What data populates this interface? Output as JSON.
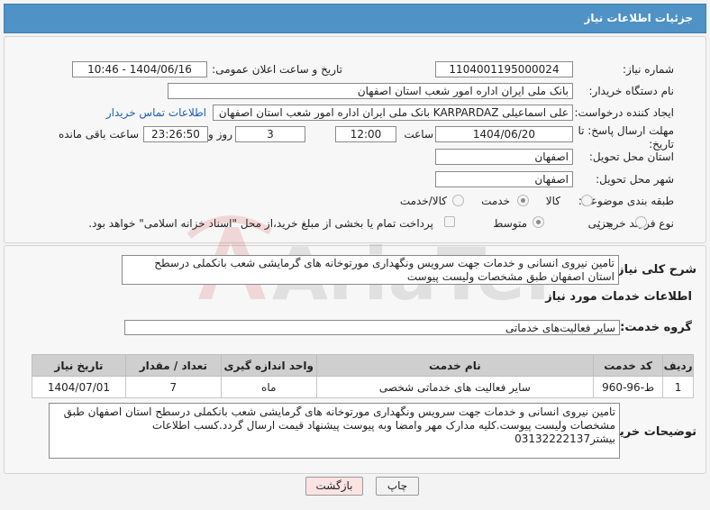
{
  "header": {
    "title": "جزئیات اطلاعات نیاز"
  },
  "form": {
    "need_number": {
      "label": "شماره نیاز:",
      "value": "1104001195000024"
    },
    "announce_datetime": {
      "label": "تاریخ و ساعت اعلان عمومی:",
      "value": "1404/06/16 - 10:46"
    },
    "buyer_org": {
      "label": "نام دستگاه خریدار:",
      "value": "بانک ملی ایران اداره امور شعب استان اصفهان"
    },
    "requester": {
      "label": "ایجاد کننده درخواست:",
      "value": "علی اسماعیلی KARPARDAZ بانک ملی ایران اداره امور شعب استان اصفهان",
      "contact_link": "اطلاعات تماس خریدار"
    },
    "deadline": {
      "label": "مهلت ارسال پاسخ: تا تاریخ:",
      "date": "1404/06/20",
      "time_label": "ساعت",
      "time": "12:00",
      "days": "3",
      "days_label": "روز و",
      "remaining": "23:26:50",
      "remaining_label": "ساعت باقی مانده"
    },
    "delivery_province": {
      "label": "استان محل تحویل:",
      "value": "اصفهان"
    },
    "delivery_city": {
      "label": "شهر محل تحویل:",
      "value": "اصفهان"
    },
    "category": {
      "label": "طبقه بندی موضوعی:",
      "options": [
        "کالا",
        "خدمت",
        "کالا/خدمت"
      ],
      "selected": "خدمت"
    },
    "process_type": {
      "label": "نوع فرآیند خرید :",
      "options": [
        "جزیی",
        "متوسط"
      ],
      "selected": "متوسط",
      "payment_note": "پرداخت تمام یا بخشی از مبلغ خرید،از محل \"اسناد خزانه اسلامی\" خواهد بود."
    }
  },
  "details": {
    "general_desc_label": "شرح کلی نیاز:",
    "general_desc": "تامین نیروی انسانی و خدمات جهت سرویس ونگهداری مورتوخانه های گرمایشی شعب بانکملی درسطح استان اصفهان طبق مشخصات ولیست پیوست",
    "services_title": "اطلاعات خدمات مورد نیاز",
    "service_group_label": "گروه خدمت:",
    "service_group": "سایر فعالیت‌های خدماتی",
    "table": {
      "headers": [
        "ردیف",
        "کد خدمت",
        "نام خدمت",
        "واحد اندازه گیری",
        "تعداد / مقدار",
        "تاریخ نیاز"
      ],
      "rows": [
        [
          "1",
          "ط-96-960",
          "سایر فعالیت های خدماتی شخصی",
          "ماه",
          "7",
          "1404/07/01"
        ]
      ]
    },
    "buyer_notes_label": "توضیحات خریدار:",
    "buyer_notes": "تامین نیروی انسانی و خدمات جهت سرویس ونگهداری مورتوخانه های گرمایشی شعب بانکملی درسطح استان اصفهان طبق مشخصات ولیست پیوست.کلیه مدارک مهر وامضا وبه پیوست پیشنهاد قیمت ارسال گردد.کسب اطلاعات بیشتر03132222137"
  },
  "buttons": {
    "print": "چاپ",
    "back": "بازگشت"
  },
  "watermark": {
    "text": "AriaTender.neT"
  },
  "colors": {
    "header": "#4f92c5",
    "link": "#1a5fb4",
    "back_button": "#fbe3e3"
  }
}
